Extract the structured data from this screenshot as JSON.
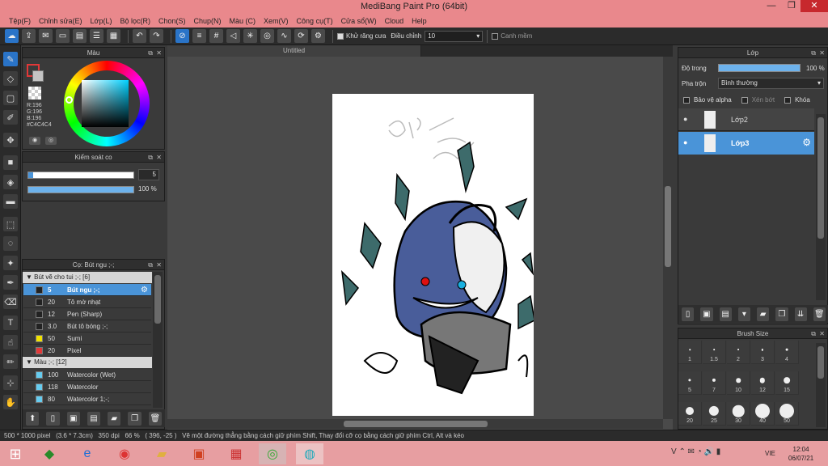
{
  "window": {
    "title": "MediBang Paint Pro (64bit)",
    "minimize": "—",
    "maximize": "❐",
    "close": "✕"
  },
  "menu": [
    "Tệp(F)",
    "Chỉnh sửa(E)",
    "Lớp(L)",
    "Bộ lọc(R)",
    "Chon(S)",
    "Chup(N)",
    "Màu (C)",
    "Xem(V)",
    "Công cụ(T)",
    "Cửa sổ(W)",
    "Cloud",
    "Help"
  ],
  "toolbar": {
    "antialias_label": "Khử răng cưa",
    "correction_label": "Điều chỉnh",
    "correction_value": "10",
    "snap_label": "Canh mềm"
  },
  "color_panel": {
    "title": "Màu",
    "r": "R:196",
    "g": "G:196",
    "b": "B:196",
    "hex": "#C4C4C4",
    "current_color": "#c4c4c4",
    "accent": "#e23838"
  },
  "brush_control": {
    "title": "Kiểm soát co",
    "size_value": "5",
    "opacity_value": "100 %",
    "opacity_fraction": 1.0
  },
  "brush_panel": {
    "title": "Cọ: Bút ngu ;-;",
    "group1": "Bút vẽ cho tui ;-; [6]",
    "group1_items": [
      {
        "size": "5",
        "name": "Bút ngu ;-;",
        "color": "#222222",
        "selected": true
      },
      {
        "size": "20",
        "name": "Tô mờ nhạt",
        "color": "#222222"
      },
      {
        "size": "12",
        "name": "Pen (Sharp)",
        "color": "#222222"
      },
      {
        "size": "3.0",
        "name": "Bút tô bóng ;-;",
        "color": "#222222"
      },
      {
        "size": "50",
        "name": "Sumi",
        "color": "#f1e200"
      },
      {
        "size": "20",
        "name": "Pixel",
        "color": "#e23838"
      }
    ],
    "group2": "Màu ;-; [12]",
    "group2_items": [
      {
        "size": "100",
        "name": "Watercolor (Wet)",
        "color": "#66ccf0"
      },
      {
        "size": "118",
        "name": "Watercolor",
        "color": "#66ccf0"
      },
      {
        "size": "80",
        "name": "Watercolor 1;-;",
        "color": "#66ccf0"
      }
    ]
  },
  "canvas": {
    "tab_title": "Untitled"
  },
  "layers_panel": {
    "title": "Lớp",
    "opacity_label": "Độ trong",
    "opacity_value": "100 %",
    "blend_label": "Pha trộn",
    "blend_value": "Bình thường",
    "protect_alpha": "Bảo vệ alpha",
    "clip": "Xén bớt",
    "lock": "Khóa",
    "layers": [
      {
        "name": "Lớp2",
        "selected": false
      },
      {
        "name": "Lớp3",
        "selected": true
      }
    ]
  },
  "brush_size_panel": {
    "title": "Brush Size",
    "sizes": [
      "1",
      "1.5",
      "2",
      "3",
      "4",
      "5",
      "7",
      "10",
      "12",
      "15",
      "20",
      "25",
      "30",
      "40",
      "50"
    ]
  },
  "status": {
    "dimensions": "500 * 1000 pixel",
    "physical": "(3.6 * 7.3cm)",
    "dpi": "350 dpi",
    "zoom": "66 %",
    "coords": "( 396, -25 )",
    "hint": "Vẽ một đường thẳng bằng cách giữ phím Shift, Thay đổi cỡ cọ bằng cách giữ phím Ctrl, Alt và kéo"
  },
  "taskbar": {
    "lang": "VIE",
    "time": "12:04",
    "date": "06/07/21"
  }
}
